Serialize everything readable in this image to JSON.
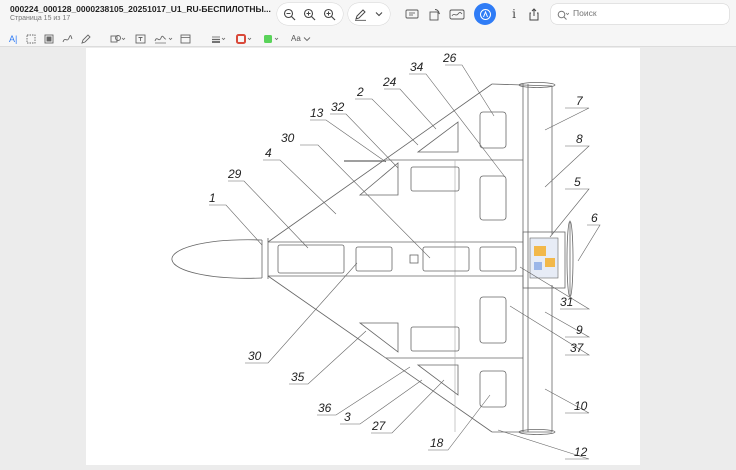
{
  "window": {
    "title": "000224_000128_0000238105_20251017_U1_RU-БЕСПИЛОТНЫ...",
    "page_info": "Страница 15 из 17"
  },
  "toolbar": {
    "search_placeholder": "Поиск",
    "info_label": "i",
    "text_style_label": "Aa",
    "icons": [
      "sidebar-icon",
      "zoom-out-icon",
      "zoom-in-icon",
      "highlight-pen-icon",
      "chevron-down-icon",
      "crop-icon",
      "rotate-icon",
      "sign-icon",
      "markup-icon",
      "info-icon",
      "share-icon",
      "search-icon"
    ],
    "accent_color": "#2f7cf6"
  },
  "markup": {
    "text_cursor_label": "A|",
    "border_color": "#d9493a",
    "fill_color": "#5ad35a"
  },
  "drawing": {
    "callouts": [
      "1",
      "2",
      "3",
      "4",
      "5",
      "6",
      "7",
      "8",
      "9",
      "10",
      "12",
      "13",
      "18",
      "24",
      "26",
      "27",
      "29",
      "30",
      "30",
      "31",
      "32",
      "34",
      "35",
      "36",
      "37"
    ]
  }
}
